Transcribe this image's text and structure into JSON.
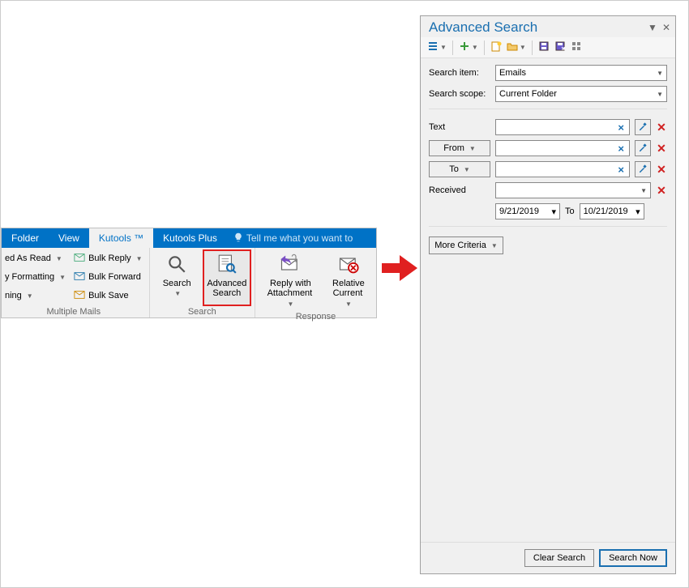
{
  "ribbon": {
    "tabs": {
      "folder": "Folder",
      "view": "View",
      "kutools": "Kutools ™",
      "kutools_plus": "Kutools Plus"
    },
    "tellme": "Tell me what you want to",
    "group1": {
      "mark_read": "ed As Read",
      "formatting": "y Formatting",
      "ning": "ning",
      "bulk_reply": "Bulk Reply",
      "bulk_forward": "Bulk Forward",
      "bulk_save": "Bulk Save",
      "label": "Multiple Mails"
    },
    "group2": {
      "search": "Search",
      "adv_line1": "Advanced",
      "adv_line2": "Search",
      "label": "Search"
    },
    "group3": {
      "reply_line1": "Reply with",
      "reply_line2": "Attachment",
      "relative_line1": "Relative",
      "relative_line2": "Current",
      "label": "Response"
    }
  },
  "panel": {
    "title": "Advanced Search",
    "search_item_label": "Search item:",
    "search_item_value": "Emails",
    "search_scope_label": "Search scope:",
    "search_scope_value": "Current Folder",
    "text_label": "Text",
    "from_label": "From",
    "to_label": "To",
    "received_label": "Received",
    "date_from": "9/21/2019",
    "date_to_sep": "To",
    "date_to": "10/21/2019",
    "more_criteria": "More Criteria",
    "clear_search": "Clear Search",
    "search_now": "Search Now"
  }
}
